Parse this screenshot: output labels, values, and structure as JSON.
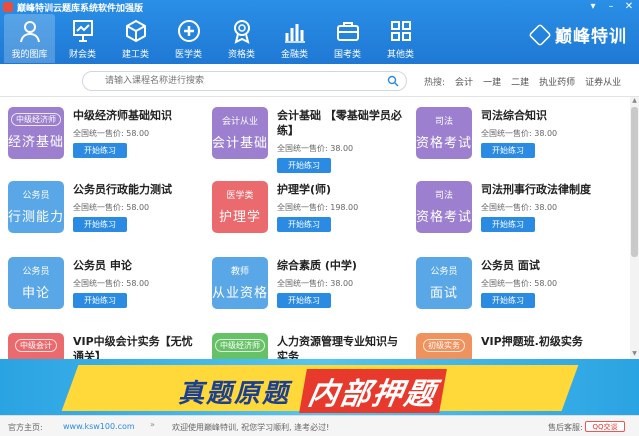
{
  "app": {
    "title": "巅峰特训云题库系统软件加强版"
  },
  "nav": [
    {
      "label": "我的图库",
      "icon": "user-icon",
      "active": true
    },
    {
      "label": "财会类",
      "icon": "chart-icon"
    },
    {
      "label": "建工类",
      "icon": "cube-icon"
    },
    {
      "label": "医学类",
      "icon": "medical-cross-icon"
    },
    {
      "label": "资格类",
      "icon": "medal-icon"
    },
    {
      "label": "金融类",
      "icon": "bar-chart-icon"
    },
    {
      "label": "国考类",
      "icon": "briefcase-icon"
    },
    {
      "label": "其他类",
      "icon": "grid-icon"
    }
  ],
  "brand": {
    "name": "巅峰特训"
  },
  "search": {
    "placeholder": "请输入课程名称进行搜索",
    "hot_label": "热搜:",
    "hot_items": [
      "会计",
      "一建",
      "二建",
      "执业药师",
      "证券从业"
    ]
  },
  "courses": [
    {
      "thumb_top": "中级经济师",
      "thumb_bottom": "经济基础",
      "color": "purple",
      "tag": true,
      "title": "中级经济师基础知识",
      "price": "全国统一售价: 58.00",
      "button": "开始练习"
    },
    {
      "thumb_top": "会计从业",
      "thumb_bottom": "会计基础",
      "color": "purple",
      "tag": false,
      "title": "会计基础 【零基础学员必练】",
      "price": "全国统一售价: 38.00",
      "button": "开始练习"
    },
    {
      "thumb_top": "司法",
      "thumb_bottom": "资格考试",
      "color": "purple",
      "tag": false,
      "title": "司法综合知识",
      "price": "全国统一售价: 38.00",
      "button": "开始练习"
    },
    {
      "thumb_top": "公务员",
      "thumb_bottom": "行测能力",
      "color": "blue",
      "tag": false,
      "title": "公务员行政能力测试",
      "price": "全国统一售价: 58.00",
      "button": "开始练习"
    },
    {
      "thumb_top": "医学类",
      "thumb_bottom": "护理学",
      "color": "red",
      "tag": false,
      "title": "护理学(师)",
      "price": "全国统一售价: 198.00",
      "button": "开始练习"
    },
    {
      "thumb_top": "司法",
      "thumb_bottom": "资格考试",
      "color": "purple",
      "tag": false,
      "title": "司法刑事行政法律制度",
      "price": "全国统一售价: 38.00",
      "button": "开始练习"
    },
    {
      "thumb_top": "公务员",
      "thumb_bottom": "申论",
      "color": "blue",
      "tag": false,
      "title": "公务员 申论",
      "price": "全国统一售价: 58.00",
      "button": "开始练习"
    },
    {
      "thumb_top": "教师",
      "thumb_bottom": "从业资格",
      "color": "blue",
      "tag": false,
      "title": "综合素质 (中学)",
      "price": "全国统一售价: 38.00",
      "button": "开始练习"
    },
    {
      "thumb_top": "公务员",
      "thumb_bottom": "面试",
      "color": "blue",
      "tag": false,
      "title": "公务员 面试",
      "price": "全国统一售价: 58.00",
      "button": "开始练习"
    },
    {
      "thumb_top": "中级会计",
      "thumb_bottom": "",
      "color": "red",
      "tag": true,
      "title": "VIP中级会计实务【无忧通关】",
      "price": "",
      "button": ""
    },
    {
      "thumb_top": "中级经济师",
      "thumb_bottom": "",
      "color": "green",
      "tag": true,
      "title": "人力资源管理专业知识与实务",
      "price": "",
      "button": ""
    },
    {
      "thumb_top": "初级实务",
      "thumb_bottom": "",
      "color": "orange",
      "tag": true,
      "title": "VIP押题班.初级实务",
      "price": "",
      "button": ""
    }
  ],
  "banner": {
    "text_left": "真题原题",
    "text_right": "内部押题"
  },
  "status": {
    "home_label": "官方主页:",
    "home_url": "www.ksw100.com",
    "chevron": "»",
    "welcome": "欢迎使用巅峰特训, 祝您学习顺利, 逢考必过!",
    "service": "售后客服:",
    "qq": "QQ交谈"
  }
}
